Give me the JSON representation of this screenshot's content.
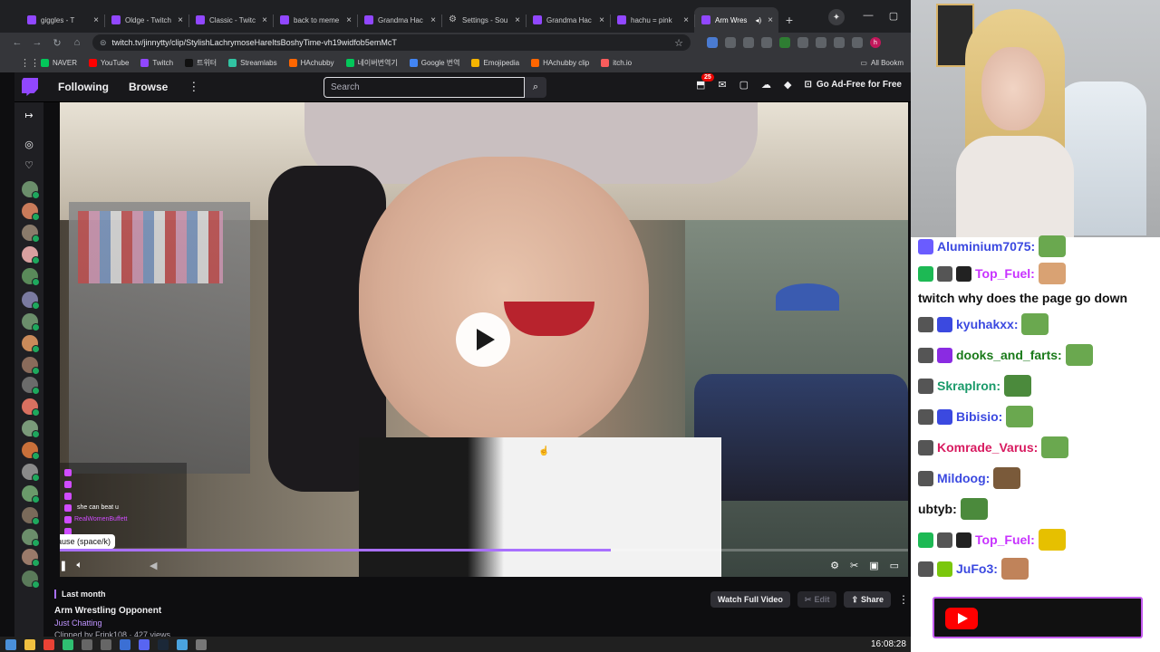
{
  "browser": {
    "tabs": [
      {
        "title": "giggles - T",
        "active": false,
        "icon": "twitch-favicon"
      },
      {
        "title": "Oldge - Twitch",
        "active": false,
        "icon": "twitch-favicon"
      },
      {
        "title": "Classic - Twitc",
        "active": false,
        "icon": "twitch-favicon"
      },
      {
        "title": "back to meme",
        "active": false,
        "icon": "twitch-favicon"
      },
      {
        "title": "Grandma Hac",
        "active": false,
        "icon": "twitch-favicon"
      },
      {
        "title": "Settings - Sou",
        "active": false,
        "icon": "gear-icon"
      },
      {
        "title": "Grandma Hac",
        "active": false,
        "icon": "twitch-favicon"
      },
      {
        "title": "hachu = pink",
        "active": false,
        "icon": "twitch-favicon"
      },
      {
        "title": "Arm Wres",
        "active": true,
        "icon": "twitch-favicon"
      }
    ],
    "url": "twitch.tv/jinnytty/clip/StylishLachrymoseHareItsBoshyTime-vh19widfob5emMcT",
    "bookmarks": [
      {
        "label": "NAVER",
        "color": "#03c75a"
      },
      {
        "label": "YouTube",
        "color": "#ff0000"
      },
      {
        "label": "Twitch",
        "color": "#9147ff"
      },
      {
        "label": "트위터",
        "color": "#111111"
      },
      {
        "label": "Streamlabs",
        "color": "#31c3a2"
      },
      {
        "label": "HAchubby",
        "color": "#ff6600"
      },
      {
        "label": "네이버번역기",
        "color": "#03c75a"
      },
      {
        "label": "Google 번역",
        "color": "#4285f4"
      },
      {
        "label": "Emojipedia",
        "color": "#f5b400"
      },
      {
        "label": "HAchubby clip",
        "color": "#ff6600"
      },
      {
        "label": "itch.io",
        "color": "#fa5c5c"
      }
    ],
    "all_bookmarks": "All Bookm",
    "profile_initial": "h"
  },
  "twitch": {
    "nav": {
      "following": "Following",
      "browse": "Browse",
      "search_placeholder": "Search",
      "notifications_count": "25",
      "adfree_label": "Go Ad-Free for Free"
    },
    "player": {
      "tooltip": "Pause (space/k)",
      "progress": 0.65,
      "overlay_chat": [
        {
          "name": "",
          "text": ""
        },
        {
          "name": "",
          "text": ""
        },
        {
          "name": "",
          "text": ""
        },
        {
          "name": "",
          "text": "she can beat u"
        },
        {
          "name": "RealWomenBuffett",
          "text": ""
        },
        {
          "name": "",
          "text": ""
        }
      ]
    },
    "clip": {
      "when": "Last month",
      "title": "Arm Wrestling Opponent",
      "category": "Just Chatting",
      "clipped_by": "Clipped by Frink108 · 427 views",
      "watch_full": "Watch Full Video",
      "edit": "Edit",
      "share": "Share"
    }
  },
  "stream_chat": [
    {
      "user": "Aluminium7075:",
      "color": "#3b49e0",
      "text": "",
      "badges": [
        "#6a5cff"
      ],
      "emotes": [
        "#6aa84f"
      ]
    },
    {
      "user": "Top_Fuel:",
      "color": "#c832ff",
      "text": "twitch why does the page go down",
      "badges": [
        "#1db954",
        "#555555",
        "#222222"
      ],
      "emotes": [
        "#d9a273"
      ]
    },
    {
      "user": "kyuhakxx:",
      "color": "#3b49e0",
      "text": "",
      "badges": [
        "#555555",
        "#3b49e0"
      ],
      "emotes": [
        "#6aa84f"
      ]
    },
    {
      "user": "dooks_and_farts:",
      "color": "#1a7a1a",
      "text": "",
      "badges": [
        "#555555",
        "#8a2be2"
      ],
      "emotes": [
        "#6aa84f"
      ]
    },
    {
      "user": "Skraplron:",
      "color": "#1a9a6a",
      "text": "",
      "badges": [
        "#555555"
      ],
      "emotes": [
        "#4b8a3c"
      ]
    },
    {
      "user": "Bibisio:",
      "color": "#3b49e0",
      "text": "",
      "badges": [
        "#555555",
        "#3b49e0"
      ],
      "emotes": [
        "#6aa84f"
      ]
    },
    {
      "user": "Komrade_Varus:",
      "color": "#d81b60",
      "text": "",
      "badges": [
        "#555555"
      ],
      "emotes": [
        "#6aa84f"
      ]
    },
    {
      "user": "Mildoog:",
      "color": "#3b49e0",
      "text": "",
      "badges": [
        "#555555"
      ],
      "emotes": [
        "#7a5a3a"
      ]
    },
    {
      "user": "ubtyb:",
      "color": "#111111",
      "text": "",
      "badges": [],
      "emotes": [
        "#4b8a3c"
      ]
    },
    {
      "user": "Top_Fuel:",
      "color": "#c832ff",
      "text": "",
      "badges": [
        "#1db954",
        "#555555",
        "#222222"
      ],
      "emotes": [
        "#e6c000"
      ]
    },
    {
      "user": "JuFo3:",
      "color": "#3b49e0",
      "text": "",
      "badges": [
        "#555555",
        "#7ac70c"
      ],
      "emotes": [
        "#c0835a"
      ]
    }
  ],
  "taskbar": {
    "time": "16:08:28"
  }
}
